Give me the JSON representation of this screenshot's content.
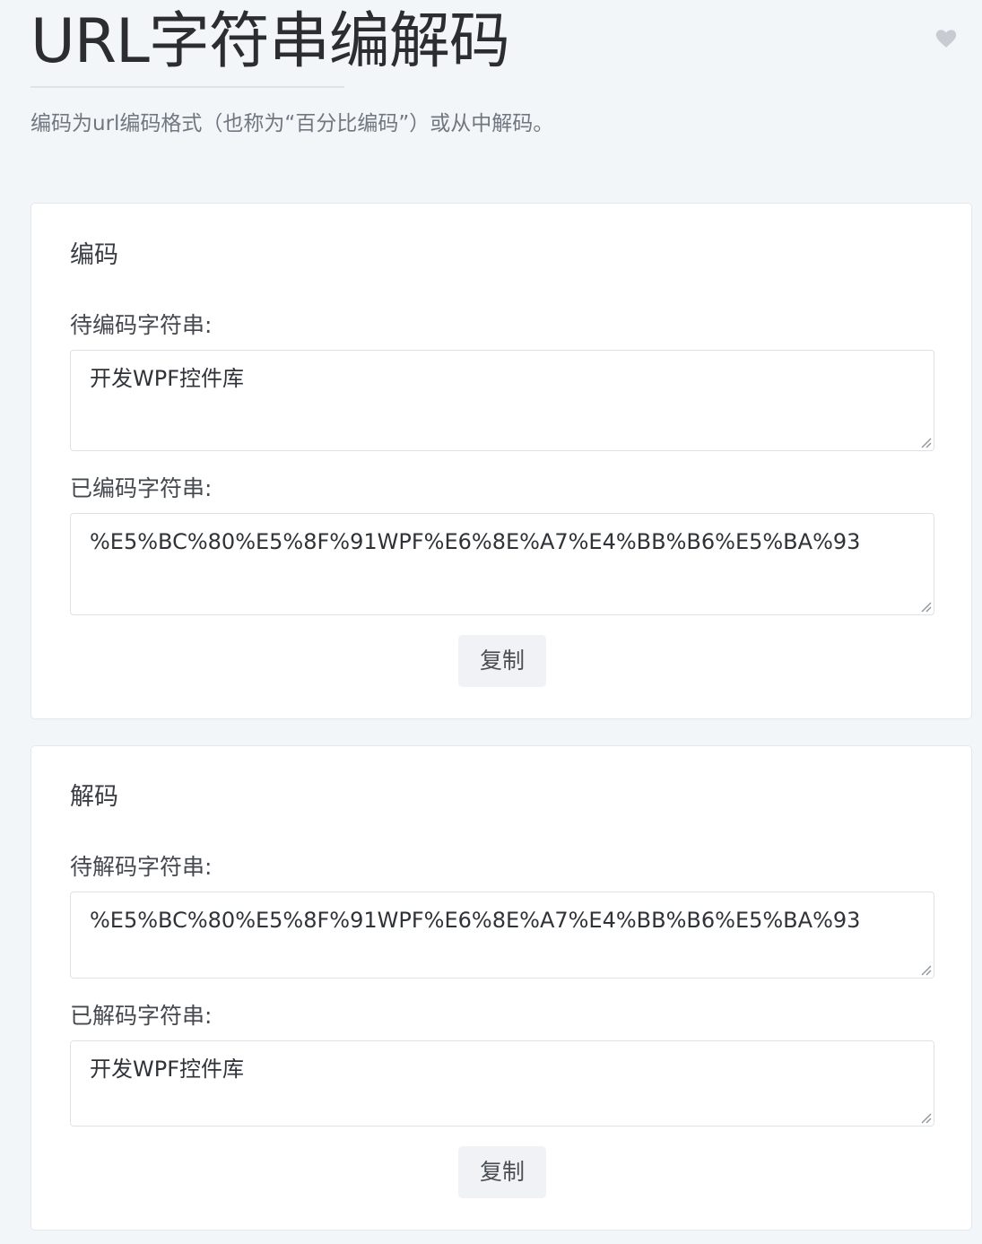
{
  "header": {
    "title": "URL字符串编解码",
    "subtitle": "编码为url编码格式（也称为“百分比编码”）或从中解码。",
    "heart_icon": "heart-icon",
    "heart_color": "#c7ccd3"
  },
  "encode": {
    "title": "编码",
    "input_label": "待编码字符串:",
    "input_value": "开发WPF控件库",
    "output_label": "已编码字符串:",
    "output_value": "%E5%BC%80%E5%8F%91WPF%E6%8E%A7%E4%BB%B6%E5%BA%93",
    "copy_label": "复制"
  },
  "decode": {
    "title": "解码",
    "input_label": "待解码字符串:",
    "input_value": "%E5%BC%80%E5%8F%91WPF%E6%8E%A7%E4%BB%B6%E5%BA%93",
    "output_label": "已解码字符串:",
    "output_value": "开发WPF控件库",
    "copy_label": "复制"
  },
  "colors": {
    "background": "#f3f6f9",
    "card": "#ffffff",
    "border": "#dde2e8",
    "button": "#f0f2f5"
  }
}
